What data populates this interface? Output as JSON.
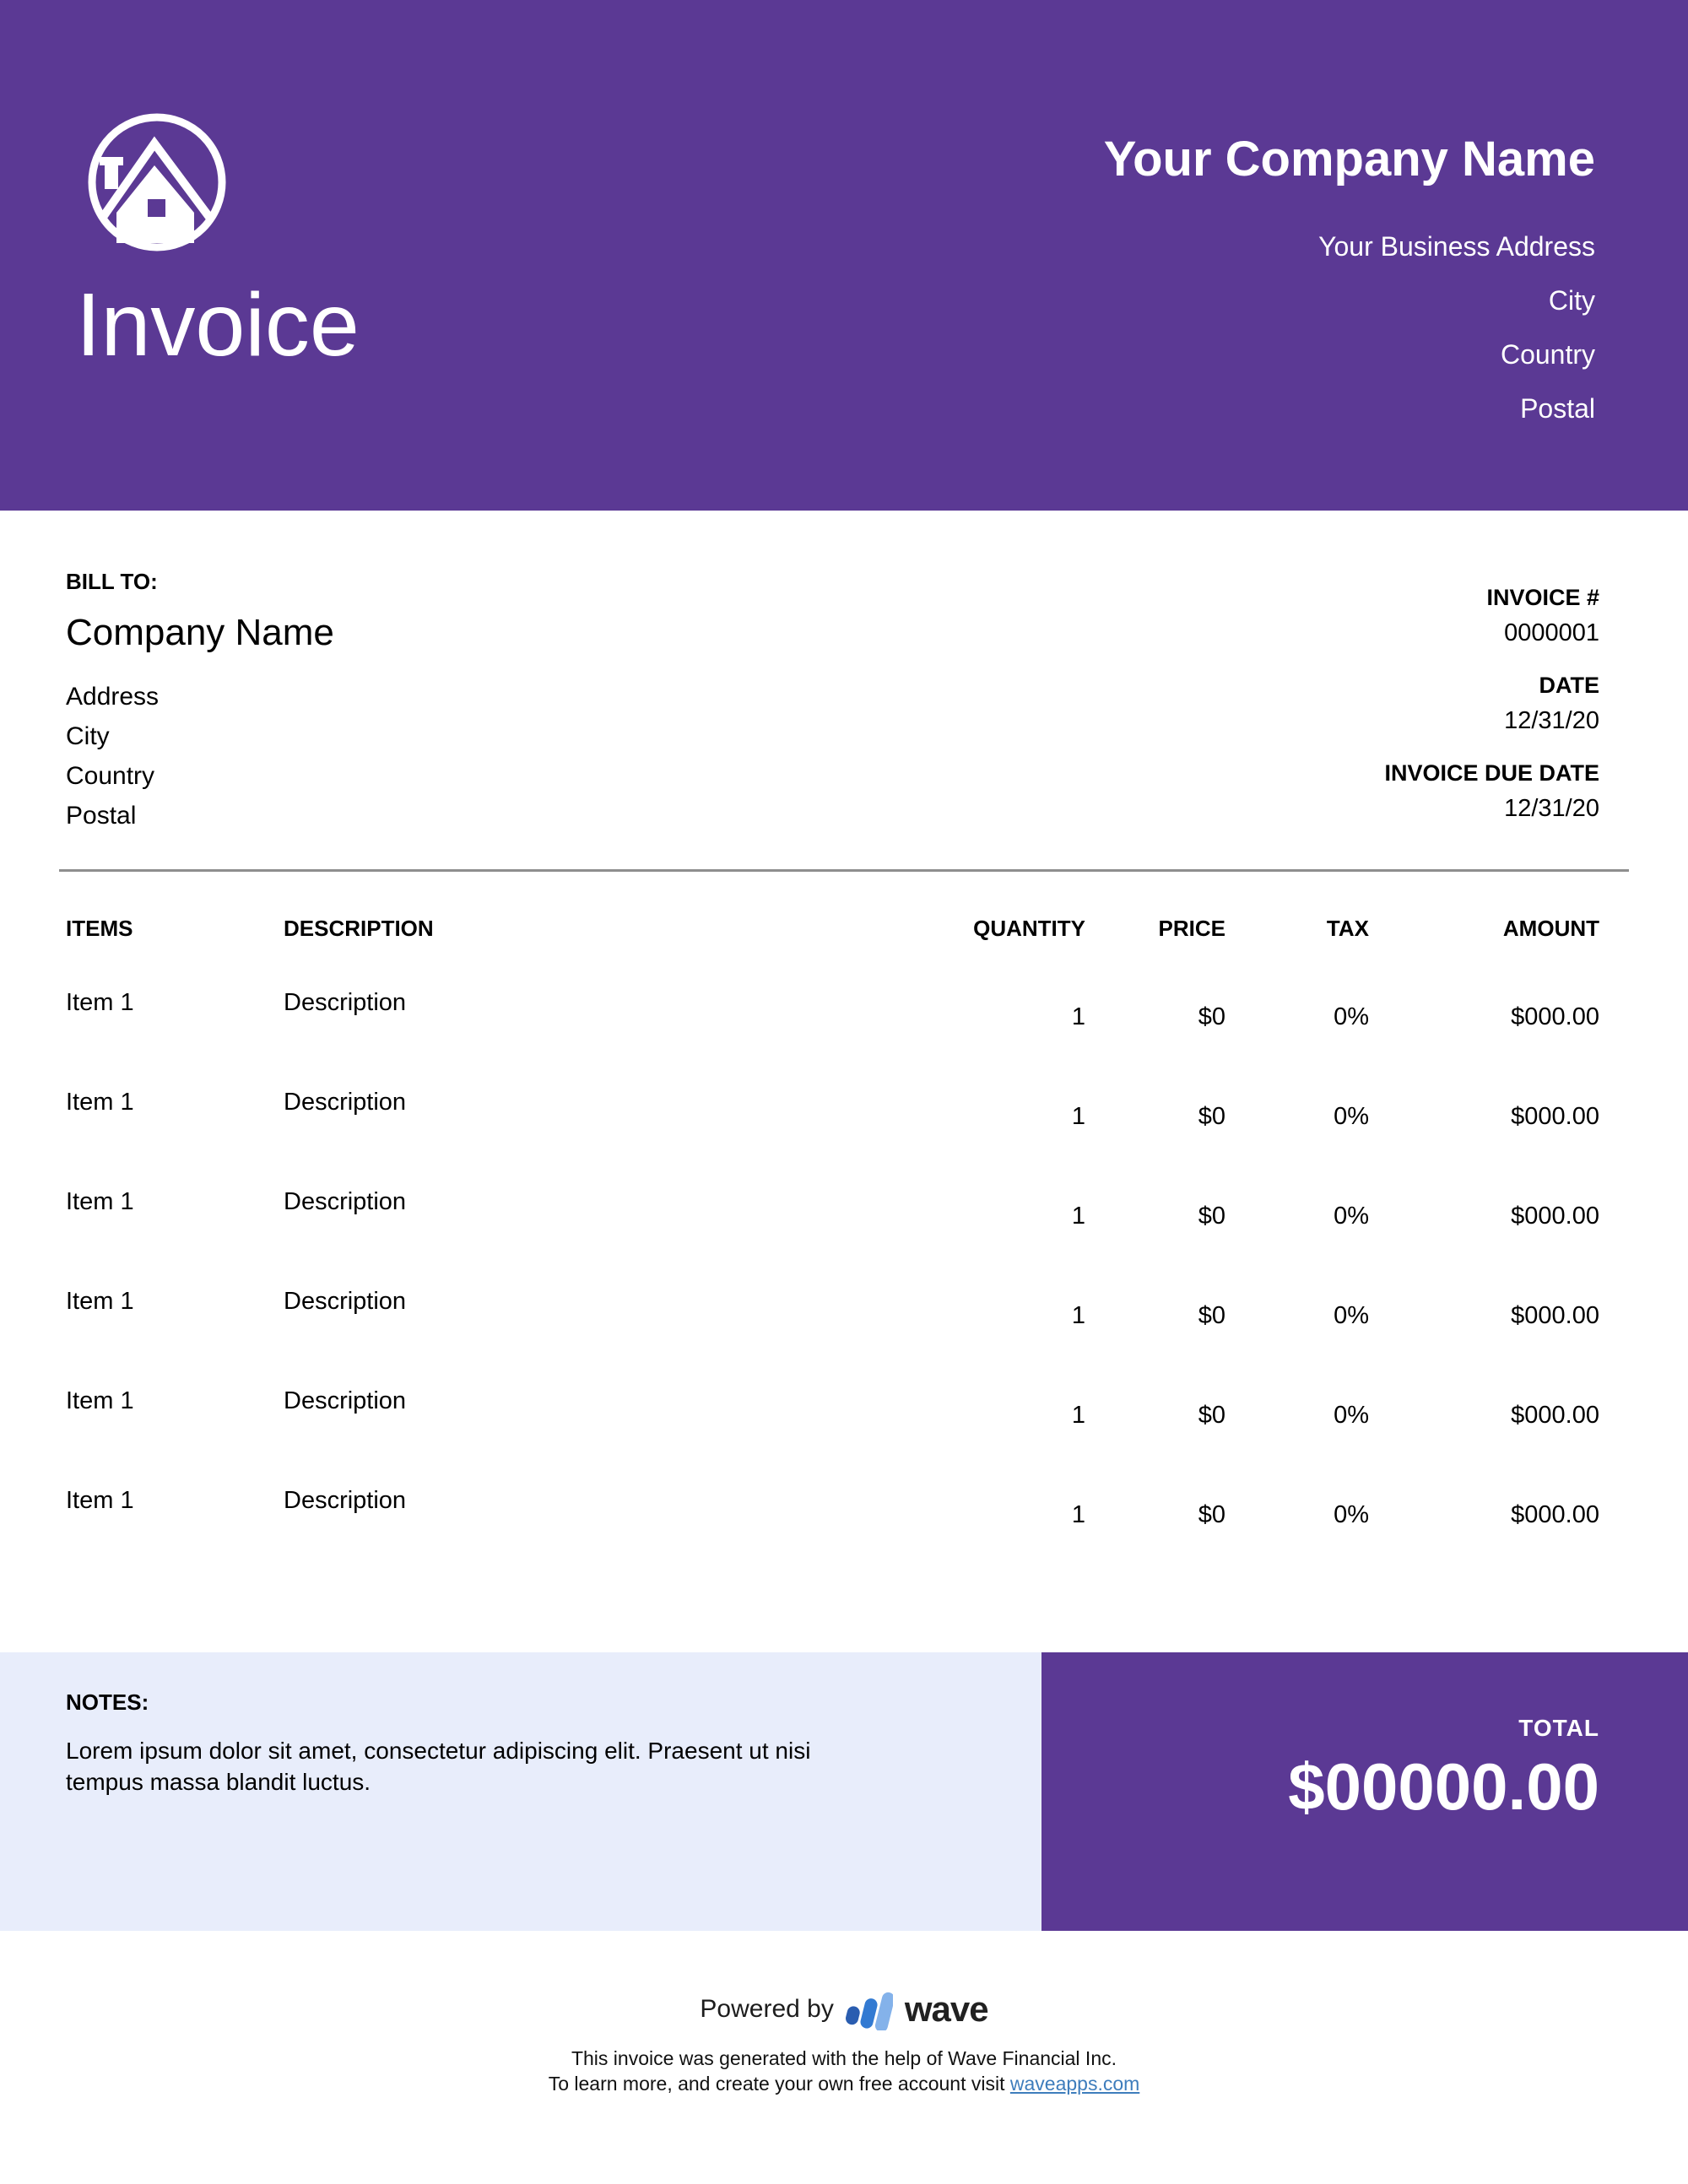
{
  "header": {
    "title": "Invoice",
    "company_name": "Your Company Name",
    "address_lines": [
      "Your Business Address",
      "City",
      "Country",
      "Postal"
    ],
    "logo_icon": "house-in-circle-icon"
  },
  "bill_to": {
    "label": "BILL TO:",
    "company": "Company Name",
    "lines": [
      "Address",
      "City",
      "Country",
      "Postal"
    ]
  },
  "invoice_meta": {
    "number_label": "INVOICE #",
    "number": "0000001",
    "date_label": "DATE",
    "date": "12/31/20",
    "due_label": "INVOICE DUE DATE",
    "due_date": "12/31/20"
  },
  "table": {
    "headers": {
      "items": "ITEMS",
      "description": "DESCRIPTION",
      "quantity": "QUANTITY",
      "price": "PRICE",
      "tax": "TAX",
      "amount": "AMOUNT"
    },
    "rows": [
      {
        "item": "Item 1",
        "description": "Description",
        "quantity": "1",
        "price": "$0",
        "tax": "0%",
        "amount": "$000.00"
      },
      {
        "item": "Item 1",
        "description": "Description",
        "quantity": "1",
        "price": "$0",
        "tax": "0%",
        "amount": "$000.00"
      },
      {
        "item": "Item 1",
        "description": "Description",
        "quantity": "1",
        "price": "$0",
        "tax": "0%",
        "amount": "$000.00"
      },
      {
        "item": "Item 1",
        "description": "Description",
        "quantity": "1",
        "price": "$0",
        "tax": "0%",
        "amount": "$000.00"
      },
      {
        "item": "Item 1",
        "description": "Description",
        "quantity": "1",
        "price": "$0",
        "tax": "0%",
        "amount": "$000.00"
      },
      {
        "item": "Item 1",
        "description": "Description",
        "quantity": "1",
        "price": "$0",
        "tax": "0%",
        "amount": "$000.00"
      }
    ]
  },
  "notes": {
    "label": "NOTES:",
    "text": "Lorem ipsum dolor sit amet, consectetur adipiscing elit. Praesent ut nisi tempus massa blandit luctus."
  },
  "total": {
    "label": "TOTAL",
    "amount": "$00000.00"
  },
  "footer": {
    "powered_by": "Powered by",
    "brand": "wave",
    "brand_icon": "wave-logo-icon",
    "generated_line": "This invoice was generated with the help of Wave Financial Inc.",
    "learn_more_prefix": "To learn more, and create your own free account visit ",
    "link_text": "waveapps.com"
  },
  "colors": {
    "purple": "#5B3994",
    "notes_background": "#E8EDFB",
    "divider_gray": "#8e8e8e",
    "link_blue": "#3E7DBC",
    "wave_word": "#212121",
    "wave_mark_dark": "#2A5DB0",
    "wave_mark_mid": "#327AD2",
    "wave_mark_light": "#84B2EA",
    "text_white": "#FFFFFF",
    "text_black": "#000000"
  }
}
